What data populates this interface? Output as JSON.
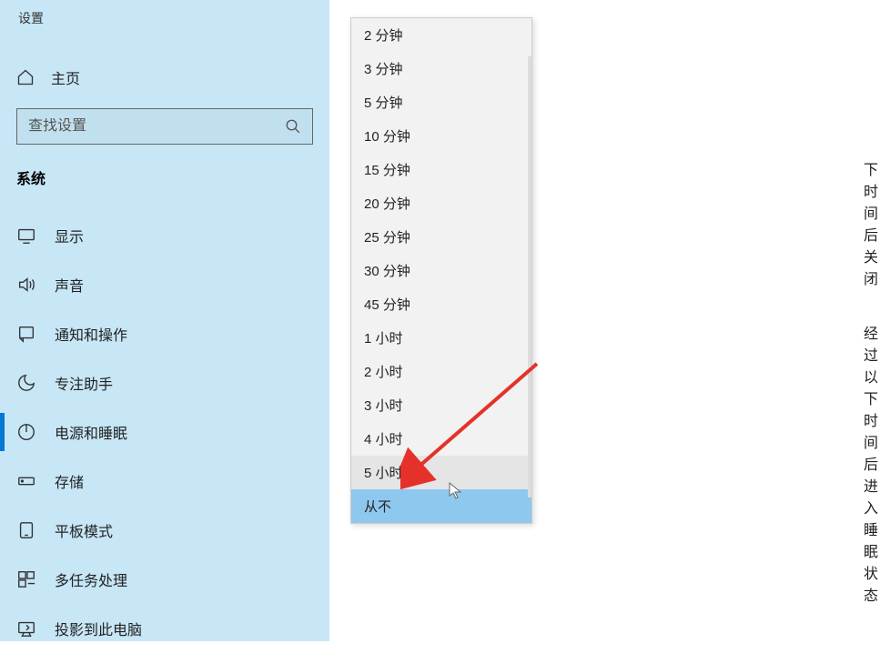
{
  "header": {
    "title": "设置"
  },
  "home": {
    "label": "主页"
  },
  "search": {
    "placeholder": "查找设置"
  },
  "section": {
    "label": "系统"
  },
  "nav": {
    "items": [
      {
        "icon": "display",
        "label": "显示"
      },
      {
        "icon": "sound",
        "label": "声音"
      },
      {
        "icon": "notification",
        "label": "通知和操作"
      },
      {
        "icon": "focus",
        "label": "专注助手"
      },
      {
        "icon": "power",
        "label": "电源和睡眠",
        "active": true
      },
      {
        "icon": "storage",
        "label": "存储"
      },
      {
        "icon": "tablet",
        "label": "平板模式"
      },
      {
        "icon": "multitask",
        "label": "多任务处理"
      },
      {
        "icon": "project",
        "label": "投影到此电脑"
      }
    ]
  },
  "hints": {
    "screenOff": "下时间后关闭",
    "sleep": "经过以下时间后进入睡眠状态"
  },
  "dropdown": {
    "options": [
      "2 分钟",
      "3 分钟",
      "5 分钟",
      "10 分钟",
      "15 分钟",
      "20 分钟",
      "25 分钟",
      "30 分钟",
      "45 分钟",
      "1 小时",
      "2 小时",
      "3 小时",
      "4 小时",
      "5 小时",
      "从不"
    ],
    "hoverIndex": 13,
    "selectedIndex": 14
  }
}
